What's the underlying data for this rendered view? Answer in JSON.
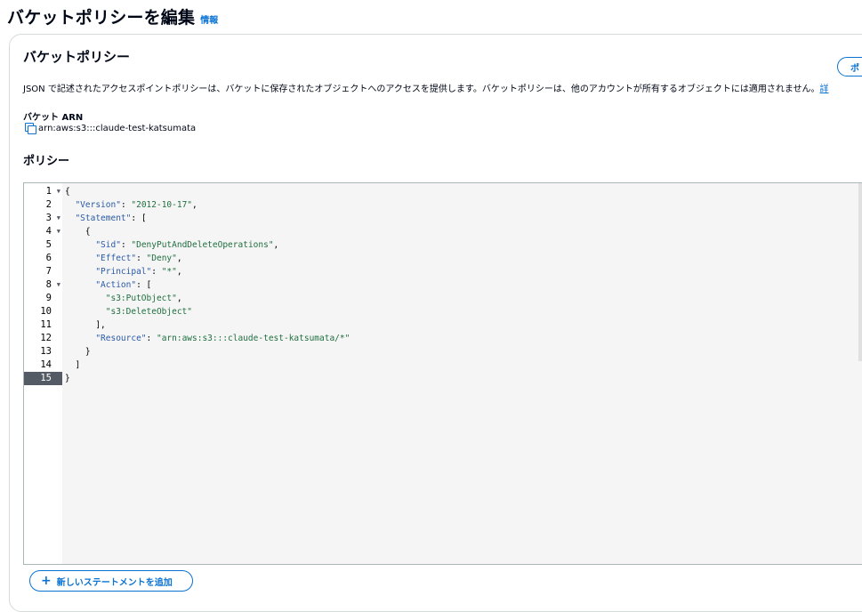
{
  "page": {
    "title": "バケットポリシーを編集",
    "info_link": "情報"
  },
  "policy_section": {
    "title": "バケットポリシー",
    "policy_generator_button": "ポ",
    "description": "JSON で記述されたアクセスポイントポリシーは、バケットに保存されたオブジェクトへのアクセスを提供します。バケットポリシーは、他のアカウントが所有するオブジェクトには適用されません。",
    "description_link": "詳",
    "arn_label": "バケット ARN",
    "arn_value": "arn:aws:s3:::claude-test-katsumata",
    "policy_label": "ポリシー",
    "add_statement_button": "新しいステートメントを追加"
  },
  "editor": {
    "active_line": 15,
    "lines": [
      {
        "num": "1",
        "fold": true,
        "text": "{"
      },
      {
        "num": "2",
        "fold": false,
        "text": "  \"Version\": \"2012-10-17\","
      },
      {
        "num": "3",
        "fold": true,
        "text": "  \"Statement\": ["
      },
      {
        "num": "4",
        "fold": true,
        "text": "    {"
      },
      {
        "num": "5",
        "fold": false,
        "text": "      \"Sid\": \"DenyPutAndDeleteOperations\","
      },
      {
        "num": "6",
        "fold": false,
        "text": "      \"Effect\": \"Deny\","
      },
      {
        "num": "7",
        "fold": false,
        "text": "      \"Principal\": \"*\","
      },
      {
        "num": "8",
        "fold": true,
        "text": "      \"Action\": ["
      },
      {
        "num": "9",
        "fold": false,
        "text": "        \"s3:PutObject\","
      },
      {
        "num": "10",
        "fold": false,
        "text": "        \"s3:DeleteObject\""
      },
      {
        "num": "11",
        "fold": false,
        "text": "      ],"
      },
      {
        "num": "12",
        "fold": false,
        "text": "      \"Resource\": \"arn:aws:s3:::claude-test-katsumata/*\""
      },
      {
        "num": "13",
        "fold": false,
        "text": "    }"
      },
      {
        "num": "14",
        "fold": false,
        "text": "  ]"
      },
      {
        "num": "15",
        "fold": false,
        "text": "}"
      }
    ]
  },
  "colors": {
    "accent": "#0972d3",
    "key": "#2a5aa8",
    "string": "#1f6f3f"
  }
}
